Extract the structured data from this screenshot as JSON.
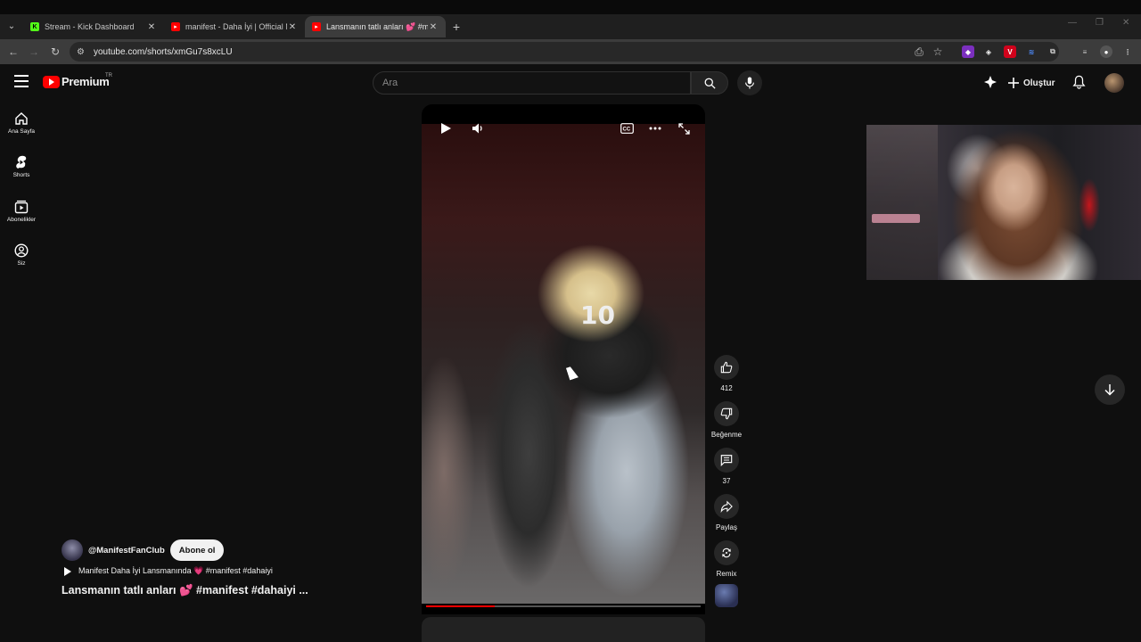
{
  "browser": {
    "tabs": [
      {
        "title": "Stream - Kick Dashboard",
        "favicon": "kick-icon",
        "active": false
      },
      {
        "title": "manifest - Daha İyi | Official Mu",
        "favicon": "youtube-icon",
        "active": false
      },
      {
        "title": "Lansmanın tatlı anları 💕 #m",
        "favicon": "youtube-icon",
        "active": true
      }
    ],
    "url": "youtube.com/shorts/xmGu7s8xcLU",
    "colors": {
      "tabstrip": "#1f1f1f",
      "toolbar": "#3c3c3c",
      "kick": "#53fc18"
    }
  },
  "header": {
    "logo_text": "Premium",
    "country_code": "TR",
    "search_placeholder": "Ara",
    "create_label": "Oluştur"
  },
  "rail": {
    "items": [
      {
        "label": "Ana Sayfa",
        "icon": "home-icon"
      },
      {
        "label": "Shorts",
        "icon": "shorts-icon"
      },
      {
        "label": "Abonelikler",
        "icon": "subscriptions-icon"
      },
      {
        "label": "Siz",
        "icon": "you-icon"
      }
    ]
  },
  "player": {
    "jersey_number": "10",
    "progress": 0.25
  },
  "actions": {
    "likes": "412",
    "dislike_label": "Beğenme",
    "comments": "37",
    "share_label": "Paylaş",
    "remix_label": "Remix"
  },
  "channel": {
    "handle": "@ManifestFanClub",
    "subscribe_label": "Abone ol",
    "sound": "Manifest Daha İyi Lansmanında 💗 #manifest #dahaiyi",
    "title": "Lansmanın tatlı anları 💕 #manifest #dahaiyi ..."
  },
  "colors": {
    "youtube_red": "#ff0000",
    "background": "#0f0f0f",
    "button_bg": "#272727"
  }
}
